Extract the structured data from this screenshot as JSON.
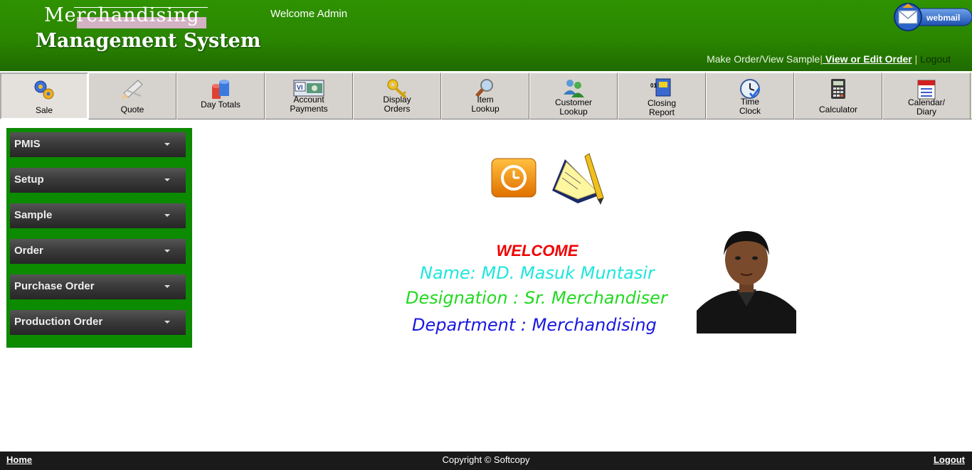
{
  "header": {
    "logo_line1": "Merchandising",
    "logo_line2": "Management System",
    "welcome": "Welcome Admin",
    "webmail_label": "webmail",
    "links": {
      "make_order": "Make Order/View Sample",
      "sep1": "|",
      "view_edit": " View or Edit Order",
      "sep2": " | ",
      "logout": "Logout"
    }
  },
  "toolbar": [
    {
      "label": "Sale",
      "icon": "gears-icon"
    },
    {
      "label": "Quote",
      "icon": "pencil-icon"
    },
    {
      "label": "Day Totals",
      "icon": "database-icon"
    },
    {
      "label": "Account\nPayments",
      "icon": "credit-card-icon"
    },
    {
      "label": "Display\nOrders",
      "icon": "keys-icon"
    },
    {
      "label": "Item\nLookup",
      "icon": "magnifier-icon"
    },
    {
      "label": "Customer\nLookup",
      "icon": "users-icon"
    },
    {
      "label": "Closing\nReport",
      "icon": "report-icon"
    },
    {
      "label": "Time\nClock",
      "icon": "clock-icon"
    },
    {
      "label": "Calculator",
      "icon": "calculator-icon"
    },
    {
      "label": "Calendar/\nDiary",
      "icon": "calendar-icon"
    }
  ],
  "sidebar": {
    "items": [
      {
        "label": "PMIS"
      },
      {
        "label": "Setup"
      },
      {
        "label": "Sample"
      },
      {
        "label": "Order"
      },
      {
        "label": "Purchase Order"
      },
      {
        "label": "Production Order"
      }
    ]
  },
  "main": {
    "welcome": "WELCOME",
    "name": "Name: MD. Masuk Muntasir",
    "designation": "Designation : Sr. Merchandiser",
    "department": "Department : Merchandising"
  },
  "footer": {
    "home": "Home",
    "copyright": "Copyright © Softcopy",
    "logout": "Logout"
  },
  "colors": {
    "header_green": "#2a8600",
    "sidebar_green": "#0c8a00",
    "welcome_red": "#f00000",
    "name_cyan": "#20e6dc",
    "designation_green": "#22d920",
    "department_blue": "#1818e0",
    "footer_bg": "#1a1a1a"
  }
}
